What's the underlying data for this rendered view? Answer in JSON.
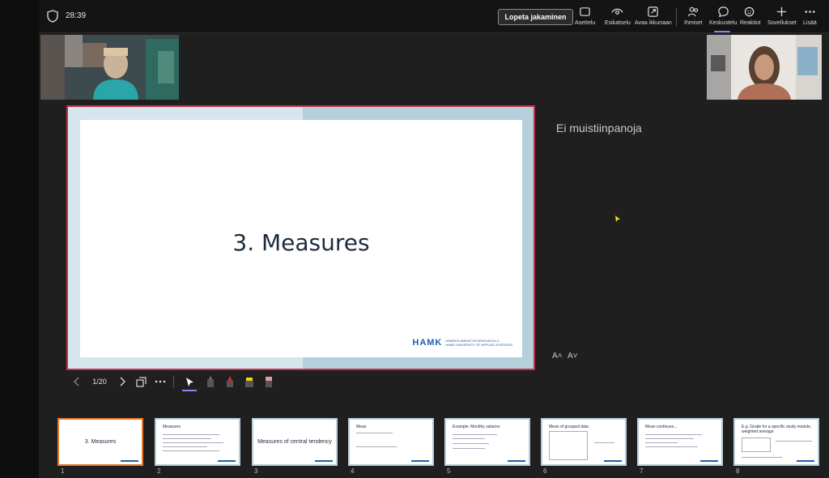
{
  "topbar": {
    "timer": "28:39",
    "stop_sharing_label": "Lopeta jakaminen",
    "tools": [
      {
        "label": "Asettelu",
        "icon": "layout-icon"
      },
      {
        "label": "Esikatselu",
        "icon": "eye-icon"
      },
      {
        "label": "Avaa ikkunaan",
        "icon": "popout-icon"
      },
      {
        "label": "Ihmiset",
        "icon": "people-icon"
      },
      {
        "label": "Keskustelu",
        "icon": "chat-icon"
      },
      {
        "label": "Reaktiot",
        "icon": "reactions-icon"
      },
      {
        "label": "Sovellukset",
        "icon": "plus-icon"
      },
      {
        "label": "Lisää",
        "icon": "more-icon"
      }
    ]
  },
  "slide": {
    "title": "3. Measures",
    "logo_word": "HAMK",
    "logo_line1": "HÄMEEN AMMATTIKORKEAKOULU",
    "logo_line2": "HÄME UNIVERSITY OF APPLIED SCIENCES"
  },
  "notes": {
    "text": "Ei muistiinpanoja",
    "font_increase": "A˄",
    "font_decrease": "A˅"
  },
  "controls": {
    "page": "1/20"
  },
  "thumbnails": [
    {
      "num": "1",
      "title": "3. Measures"
    },
    {
      "num": "2",
      "title": "Measures"
    },
    {
      "num": "3",
      "title": "Measures of central tendency"
    },
    {
      "num": "4",
      "title": "Mean"
    },
    {
      "num": "5",
      "title": "Example: Monthly salaries"
    },
    {
      "num": "6",
      "title": "Mean of grouped data"
    },
    {
      "num": "7",
      "title": "Mean continues..."
    },
    {
      "num": "8",
      "title": "E.g. Grade for a specific study module, weighted average"
    }
  ],
  "colors": {
    "accent": "#7f85f5",
    "stop_share_border": "#8a8a8a",
    "slide_border": "#c4314b",
    "thumb_active": "#e97b2f"
  }
}
